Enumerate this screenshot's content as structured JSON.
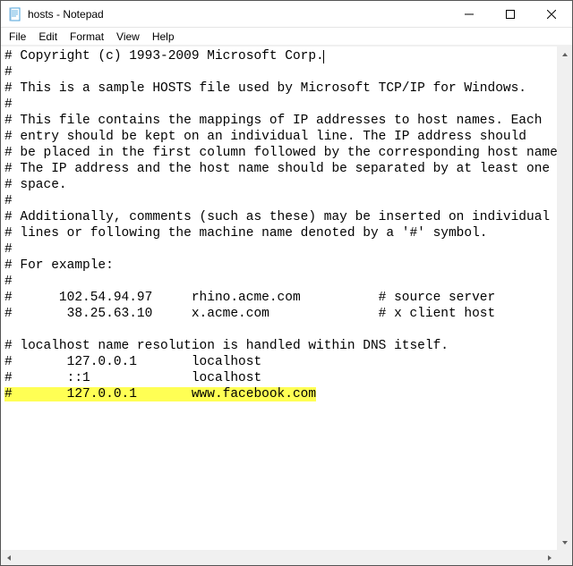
{
  "window": {
    "title": "hosts - Notepad"
  },
  "menu": {
    "file": "File",
    "edit": "Edit",
    "format": "Format",
    "view": "View",
    "help": "Help"
  },
  "content": {
    "l0": "# Copyright (c) 1993-2009 Microsoft Corp.",
    "l1": "#",
    "l2": "# This is a sample HOSTS file used by Microsoft TCP/IP for Windows.",
    "l3": "#",
    "l4": "# This file contains the mappings of IP addresses to host names. Each",
    "l5": "# entry should be kept on an individual line. The IP address should",
    "l6": "# be placed in the first column followed by the corresponding host name.",
    "l7": "# The IP address and the host name should be separated by at least one",
    "l8": "# space.",
    "l9": "#",
    "l10": "# Additionally, comments (such as these) may be inserted on individual",
    "l11": "# lines or following the machine name denoted by a '#' symbol.",
    "l12": "#",
    "l13": "# For example:",
    "l14": "#",
    "l15": "#      102.54.94.97     rhino.acme.com          # source server",
    "l16": "#       38.25.63.10     x.acme.com              # x client host",
    "l17_blank": "",
    "l18": "# localhost name resolution is handled within DNS itself.",
    "l19": "#       127.0.0.1       localhost",
    "l20": "#       ::1             localhost",
    "l21_hl": "#       127.0.0.1       www.facebook.com"
  }
}
